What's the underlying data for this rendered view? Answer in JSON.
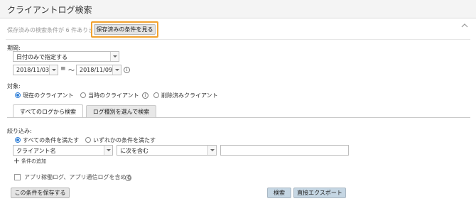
{
  "header": {
    "title": "クライアントログ検索"
  },
  "saved": {
    "note": "保存済みの検索条件が 6 件あります。",
    "button_label": "保存済みの条件を見る"
  },
  "period": {
    "label": "期間:",
    "mode_value": "日付のみで指定する",
    "from_date": "2018/11/03",
    "eq_sign": "≡",
    "tilde": "～",
    "to_date": "2018/11/09"
  },
  "target": {
    "label": "対象:",
    "options": [
      {
        "label": "現在のクライアント",
        "selected": true
      },
      {
        "label": "当時のクライアント",
        "selected": false
      },
      {
        "label": "削除済みクライアント",
        "selected": false
      }
    ]
  },
  "tabs": [
    {
      "label": "すべてのログから検索",
      "active": true
    },
    {
      "label": "ログ種別を選んで検索",
      "active": false
    }
  ],
  "filter": {
    "label": "絞り込み:",
    "match_options": [
      {
        "label": "すべての条件を満たす",
        "selected": true
      },
      {
        "label": "いずれかの条件を満たす",
        "selected": false
      }
    ],
    "field_value": "クライアント名",
    "operator_value": "に次を含む",
    "text_value": "",
    "add_label": "条件の追加"
  },
  "app_log": {
    "label": "アプリ稼働ログ、アプリ通信ログを含める",
    "checked": false
  },
  "buttons": {
    "save": "この条件を保存する",
    "search": "検索",
    "export": "直接エクスポート"
  },
  "info_glyph": "i",
  "colors": {
    "highlight": "#f2a230",
    "accent": "#2f7fd8",
    "button_blue": "#c5d6e3"
  }
}
